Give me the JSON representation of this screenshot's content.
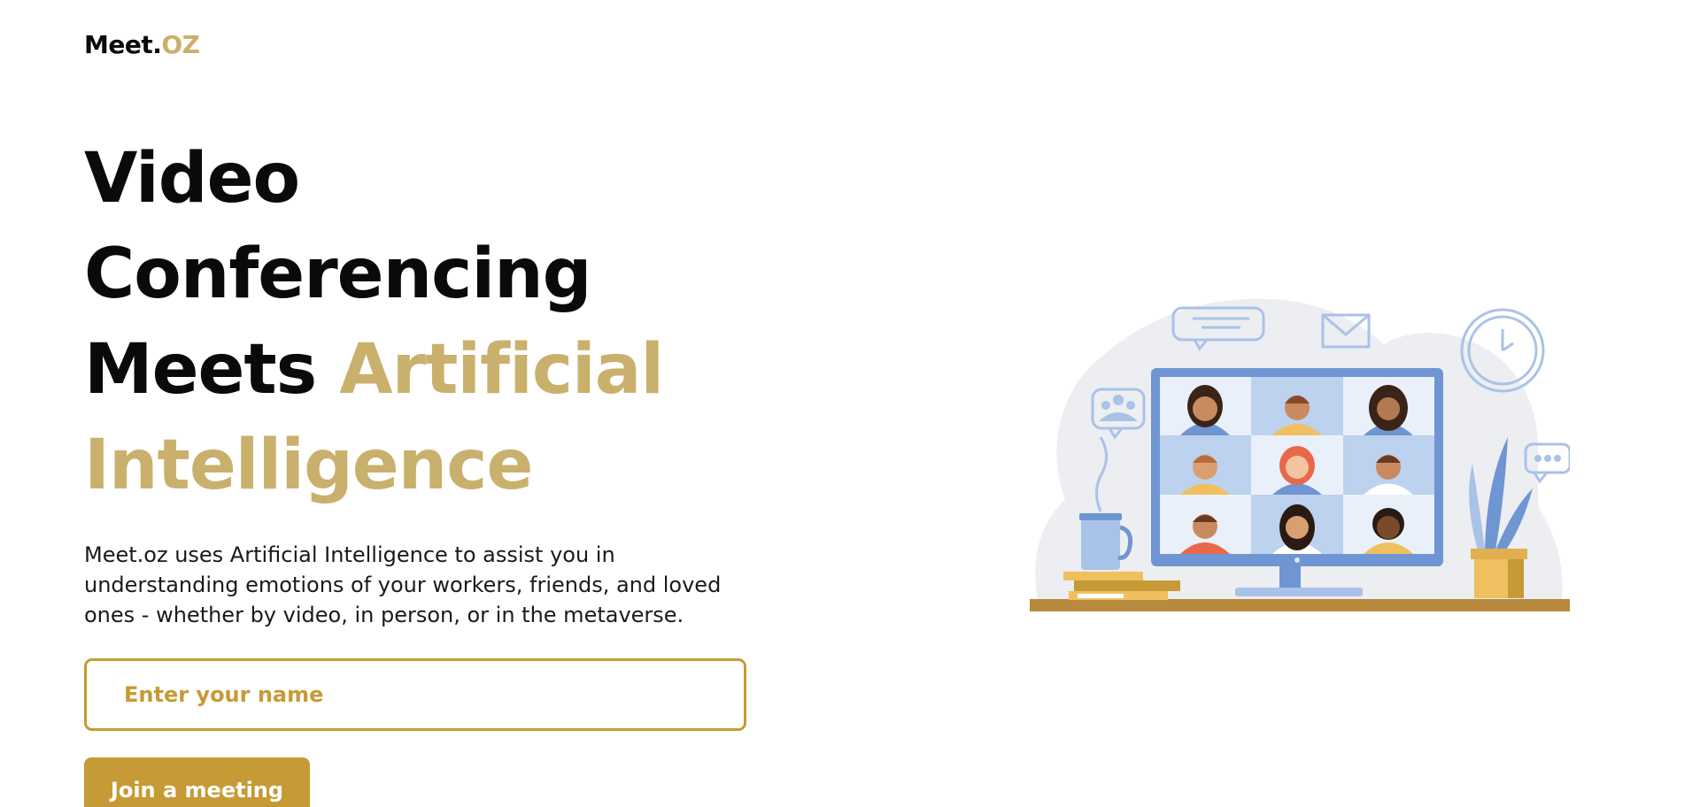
{
  "logo": {
    "text_main": "Meet.",
    "text_accent": "OZ"
  },
  "hero": {
    "headline": {
      "line1": "Video",
      "line2": "Conferencing",
      "line3_plain": "Meets ",
      "line3_accent": "Artificial",
      "line4_accent": "Intelligence"
    },
    "description": "Meet.oz uses Artificial Intelligence to assist you in understanding emotions of your workers, friends, and loved ones - whether by video, in person, or in the metaverse."
  },
  "form": {
    "name_input": {
      "value": "",
      "placeholder": "Enter your name"
    },
    "join_button_label": "Join a meeting"
  },
  "colors": {
    "accent_gold": "#c9b06c",
    "button_gold": "#c69a35",
    "text_dark": "#0a0a0a",
    "illustration_blue": "#6f95d3",
    "illustration_light_blue": "#bcd2ee"
  },
  "illustration": {
    "icons": [
      "people-chat-icon",
      "chat-bubble-icon",
      "mail-icon",
      "clock-icon",
      "typing-bubble-icon",
      "mug-icon",
      "books-icon",
      "plant-icon",
      "monitor-icon"
    ],
    "participants_count": 9
  }
}
